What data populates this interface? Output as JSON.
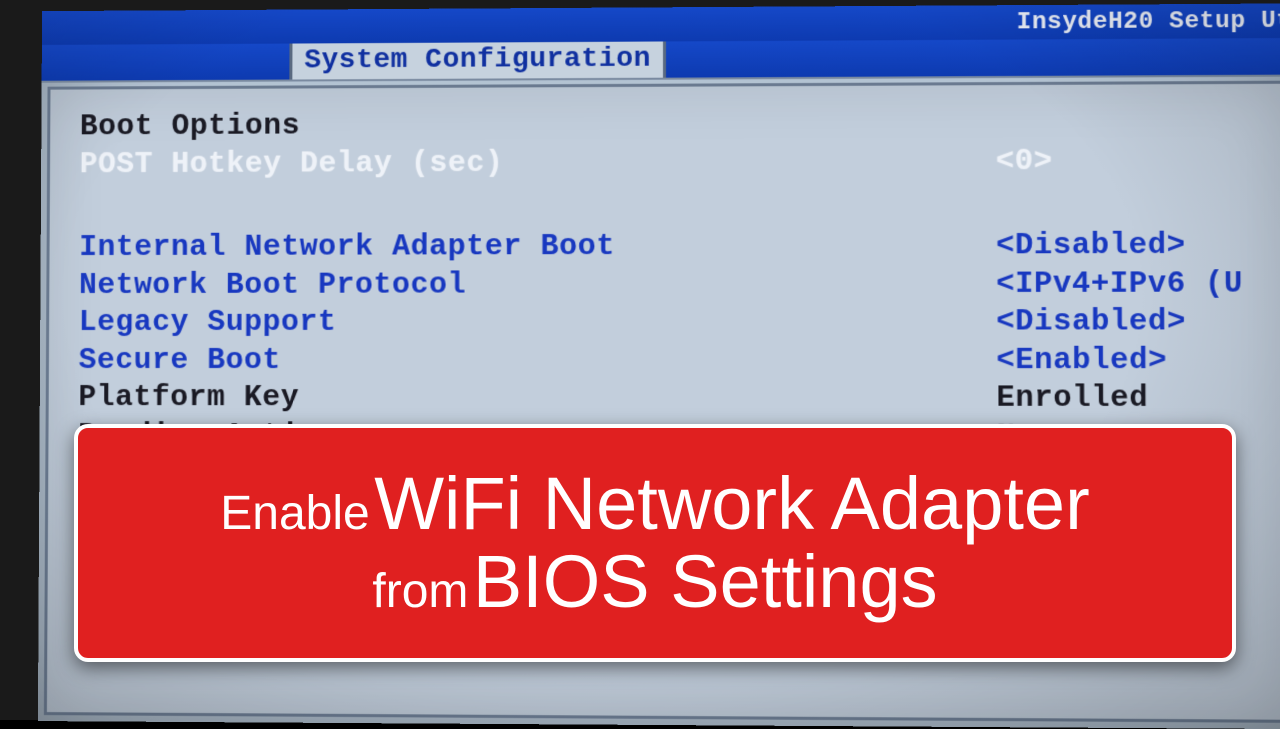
{
  "top": {
    "utility_title": "InsydeH20 Setup Ut"
  },
  "tab": {
    "label": "System Configuration"
  },
  "rows": {
    "boot_options": {
      "label": "Boot Options",
      "value": ""
    },
    "post_hotkey": {
      "label": "POST Hotkey Delay (sec)",
      "value": "<0>"
    },
    "internal_net": {
      "label": "Internal Network Adapter Boot",
      "value": "<Disabled>"
    },
    "net_proto": {
      "label": "Network Boot Protocol",
      "value": "<IPv4+IPv6 (U"
    },
    "legacy": {
      "label": "Legacy Support",
      "value": "<Disabled>"
    },
    "secure_boot": {
      "label": "Secure Boot",
      "value": "<Enabled>"
    },
    "platform_key": {
      "label": "Platform Key",
      "value": "Enrolled"
    },
    "pending": {
      "label": "Pending Action",
      "value": "None"
    }
  },
  "overlay": {
    "w1": "Enable",
    "w2": "WiFi Network Adapter",
    "w3": "from",
    "w4": "BIOS Settings"
  }
}
